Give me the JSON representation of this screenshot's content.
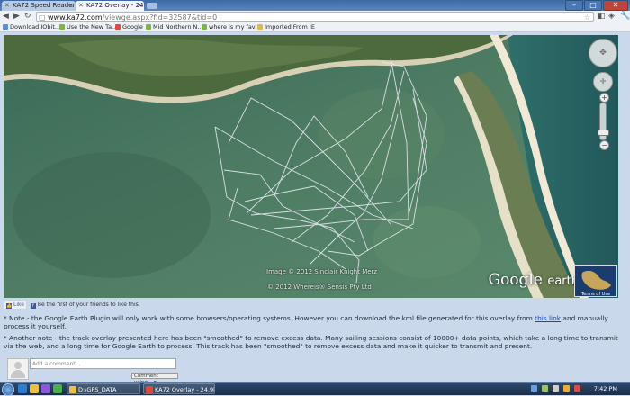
{
  "browser": {
    "tabs": [
      {
        "label": "KA72 Speed Reader",
        "active": false
      },
      {
        "label": "KA72 Overlay - 24.9k",
        "active": true
      }
    ],
    "address": {
      "host": "www.ka72.com",
      "path": "/viewge.aspx?fid=32587&tid=0"
    },
    "bookmarks": [
      "Download IObit...",
      "Use the New Ta...",
      "Google",
      "Mid Northern N...",
      "where is my fav...",
      "Imported From IE"
    ]
  },
  "map": {
    "credits": [
      "Image © 2012 Sinclair Knight Merz",
      "© 2012 Whereis® Sensis Pty Ltd"
    ],
    "logo": {
      "word1": "Google",
      "word2": "earth"
    },
    "minimap_label": "Terms of Use",
    "zoom_level": 0.85
  },
  "social": {
    "like_label": "Like",
    "friends_text": "Be the first of your friends to like this."
  },
  "notes": {
    "note1_before": "* Note - the Google Earth Plugin will only work with some browsers/operating systems. However you can download the kml file generated for this overlay from ",
    "note1_link": "this link",
    "note1_after": " and manually process it yourself.",
    "note2": "* Another note - the track overlay presented here has been \"smoothed\" to remove excess data. Many sailing sessions consist of 10000+ data points, which take a long time to transmit via the web, and a long time for Google Earth to process. This track has been \"smoothed\" to remove excess data and make it quicker to transmit and present."
  },
  "comments": {
    "placeholder": "Add a comment...",
    "select_value": "Comment using..."
  },
  "taskbar": {
    "items": [
      "D:\\GPS_DATA",
      "KA72 Overlay - 24.9k..."
    ],
    "clock": "7:42 PM"
  }
}
